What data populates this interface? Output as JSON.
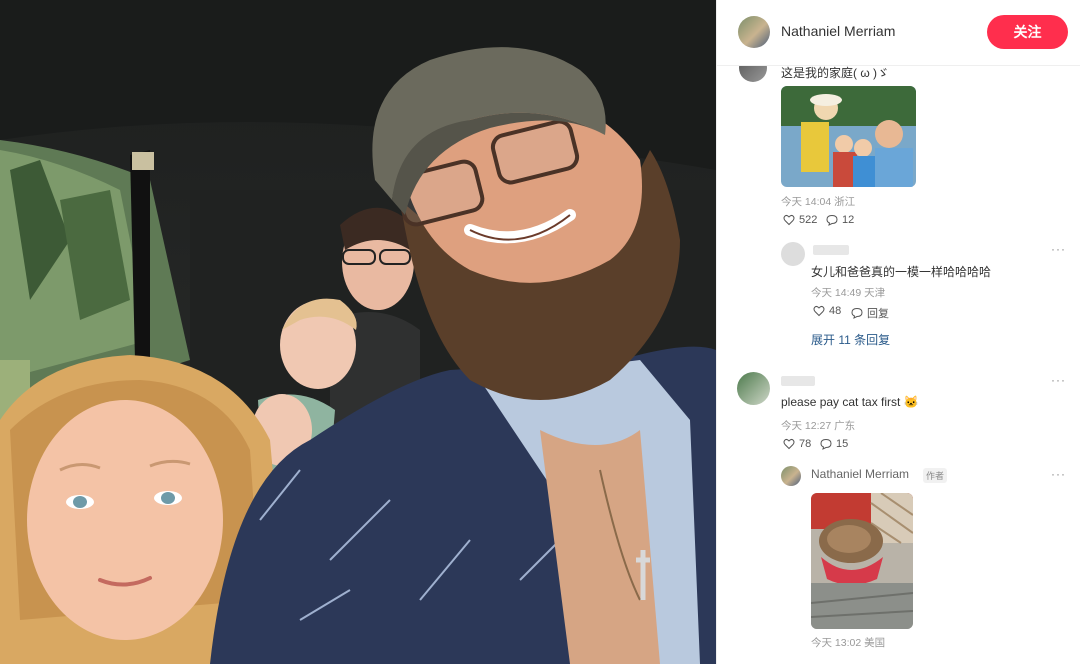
{
  "header": {
    "author_name": "Nathaniel Merriam",
    "follow_label": "关注"
  },
  "comments": [
    {
      "text": "这是我的家庭( ω )ゞ",
      "time": "今天 14:04",
      "location": "浙江",
      "likes": "522",
      "replies": "12",
      "sub": {
        "text": "女儿和爸爸真的一模一样哈哈哈哈",
        "time": "今天 14:49",
        "location": "天津",
        "likes": "48",
        "reply_label": "回复",
        "more": "···"
      },
      "expand_label": "展开 11 条回复"
    },
    {
      "text": "please pay cat tax first 🐱",
      "time": "今天 12:27",
      "location": "广东",
      "likes": "78",
      "replies": "15",
      "more": "···",
      "sub": {
        "name": "Nathaniel Merriam",
        "tag": "作者",
        "time": "今天 13:02",
        "location": "美国",
        "more": "···"
      }
    }
  ]
}
